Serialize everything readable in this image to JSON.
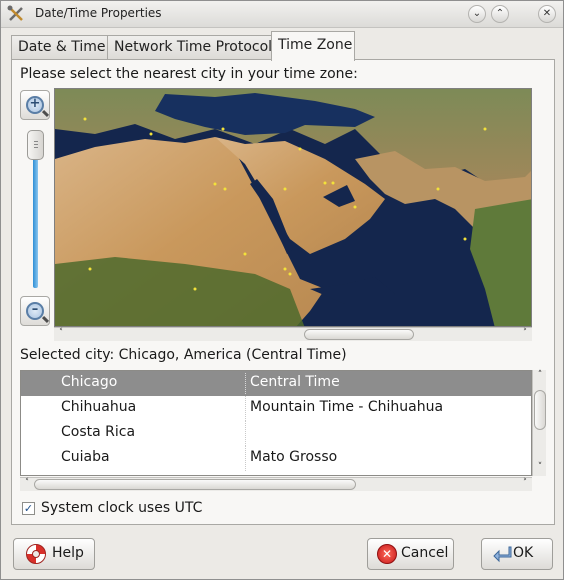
{
  "window": {
    "title": "Date/Time Properties"
  },
  "tabs": [
    {
      "label": "Date & Time"
    },
    {
      "label": "Network Time Protocol"
    },
    {
      "label": "Time Zone"
    }
  ],
  "active_tab": "Time Zone",
  "timezone": {
    "prompt": "Please select the nearest city in your time zone:",
    "selected_city": "Selected city: Chicago, America (Central Time)",
    "list": {
      "rows": [
        {
          "city": "Chicago",
          "zone": "Central Time",
          "selected": true
        },
        {
          "city": "Chihuahua",
          "zone": "Mountain Time - Chihuahua"
        },
        {
          "city": "Costa Rica",
          "zone": ""
        },
        {
          "city": "Cuiaba",
          "zone": "Mato Grosso"
        }
      ]
    }
  },
  "utc": {
    "label": "System clock uses UTC",
    "checked": true,
    "check_glyph": "✓"
  },
  "buttons": {
    "help": "Help",
    "cancel": "Cancel",
    "ok": "OK"
  },
  "icons": {
    "app": "tools-icon",
    "zoom_in": "zoom-in-icon",
    "zoom_out": "zoom-out-icon",
    "help": "lifebuoy-icon",
    "cancel": "cancel-icon",
    "ok": "ok-arrow-icon"
  },
  "colors": {
    "selection": "#8d8d8d",
    "slider": "#2f8fd5",
    "ocean": "#14264d"
  }
}
